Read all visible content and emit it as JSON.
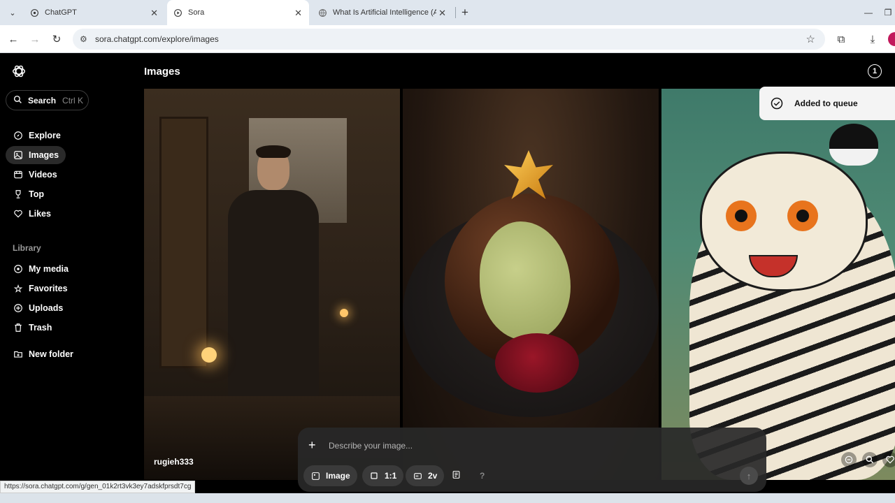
{
  "browser": {
    "tabs": [
      {
        "title": "ChatGPT",
        "active": false
      },
      {
        "title": "Sora",
        "active": true
      },
      {
        "title": "What Is Artificial Intelligence (A",
        "active": false
      }
    ],
    "url": "sora.chatgpt.com/explore/images",
    "status_url": "https://sora.chatgpt.com/g/gen_01k2rt3vk3ey7adskfprsdt7cg"
  },
  "sidebar": {
    "search_label": "Search",
    "search_shortcut": "Ctrl K",
    "nav": [
      {
        "label": "Explore",
        "icon": "compass-icon"
      },
      {
        "label": "Images",
        "icon": "image-icon",
        "active": true
      },
      {
        "label": "Videos",
        "icon": "video-icon"
      },
      {
        "label": "Top",
        "icon": "trophy-icon"
      },
      {
        "label": "Likes",
        "icon": "heart-icon"
      }
    ],
    "library_label": "Library",
    "library": [
      {
        "label": "My media",
        "icon": "media-icon"
      },
      {
        "label": "Favorites",
        "icon": "star-icon"
      },
      {
        "label": "Uploads",
        "icon": "upload-icon"
      },
      {
        "label": "Trash",
        "icon": "trash-icon"
      }
    ],
    "new_folder_label": "New folder"
  },
  "main": {
    "title": "Images",
    "queue_count": "1",
    "toast": "Added to queue",
    "first_author": "rugieh333"
  },
  "composer": {
    "placeholder": "Describe your image...",
    "type_label": "Image",
    "ratio_label": "1:1",
    "variations_label": "2v",
    "help_label": "?"
  }
}
